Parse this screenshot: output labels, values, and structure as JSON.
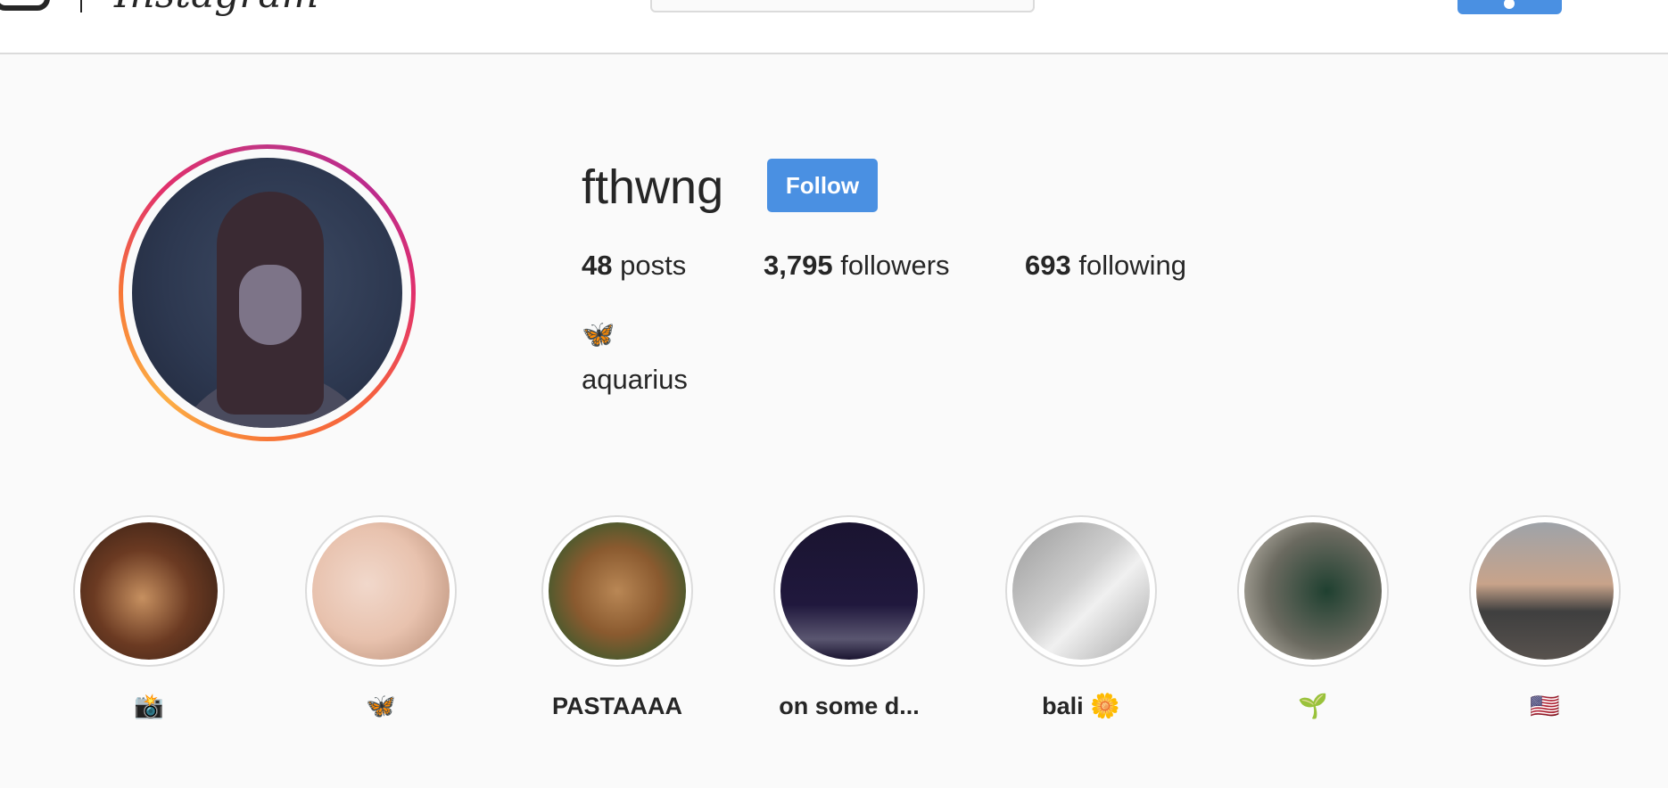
{
  "profile": {
    "username": "fthwng",
    "follow_label": "Follow",
    "stats": {
      "posts_count": "48",
      "posts_label": "posts",
      "followers_count": "3,795",
      "followers_label": "followers",
      "following_count": "693",
      "following_label": "following"
    },
    "bio_emoji": "🦋",
    "bio_text": "aquarius"
  },
  "highlights": [
    {
      "label": "📸"
    },
    {
      "label": "🦋"
    },
    {
      "label": "PASTAAAA"
    },
    {
      "label": "on some d..."
    },
    {
      "label": "bali 🌼"
    },
    {
      "label": "🌱"
    },
    {
      "label": "🇺🇸"
    }
  ],
  "colors": {
    "accent": "#4a90e2",
    "story_ring_start": "#c13584",
    "story_ring_end": "#f77737",
    "background": "#fafafa"
  }
}
